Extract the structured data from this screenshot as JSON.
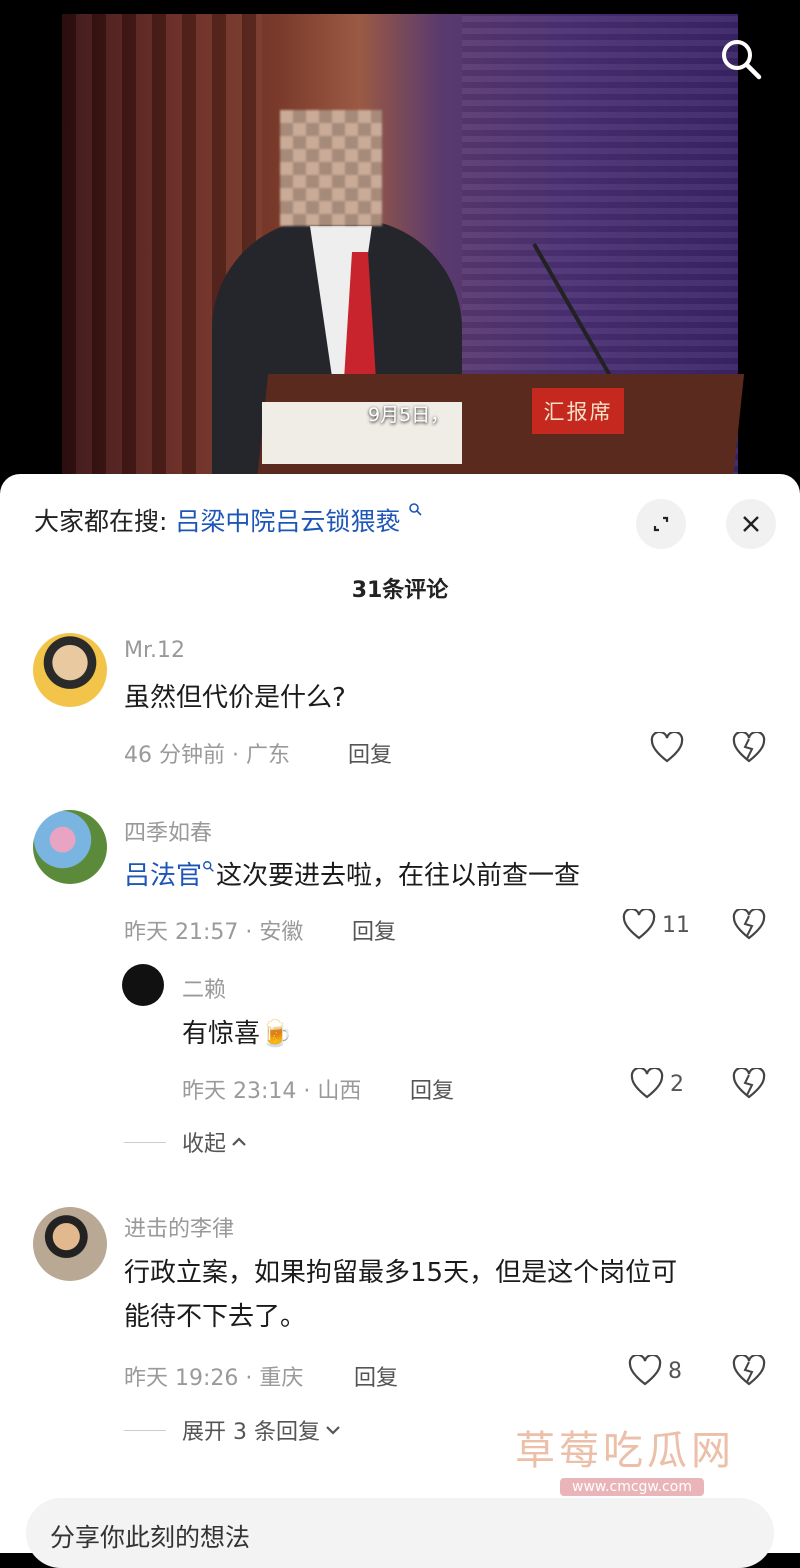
{
  "video": {
    "caption": "9月5日，",
    "podium_sign": "汇报席",
    "search_icon": "search-icon"
  },
  "sheet": {
    "trend_label": "大家都在搜:",
    "trend_query": "吕梁中院吕云锁猥亵",
    "comment_count": "31条评论",
    "expand_icon": "expand-icon",
    "close_icon": "close-icon"
  },
  "comments": [
    {
      "user": "Mr.12",
      "text": "虽然但代价是什么?",
      "meta": "46 分钟前 · 广东",
      "reply": "回复",
      "likes": ""
    },
    {
      "user": "四季如春",
      "mention": "吕法官",
      "text": "这次要进去啦，在往以前查一查",
      "meta": "昨天 21:57 · 安徽",
      "reply": "回复",
      "likes": "11",
      "sub": {
        "user": "二赖",
        "text": "有惊喜",
        "emoji": "🍺",
        "meta": "昨天 23:14 · 山西",
        "reply": "回复",
        "likes": "2"
      },
      "fold_label": "收起"
    },
    {
      "user": "进击的李律",
      "text_line1": "行政立案，如果拘留最多15天，但是这个岗位可",
      "text_line2": "能待不下去了。",
      "meta": "昨天 19:26 · 重庆",
      "reply": "回复",
      "likes": "8",
      "expand_label": "展开 3 条回复"
    }
  ],
  "input": {
    "placeholder": "分享你此刻的想法"
  },
  "watermark": {
    "text": "草莓吃瓜网",
    "url": "www.cmcgw.com"
  },
  "colors": {
    "link": "#1e56b8",
    "meta": "#9a9a9a"
  }
}
